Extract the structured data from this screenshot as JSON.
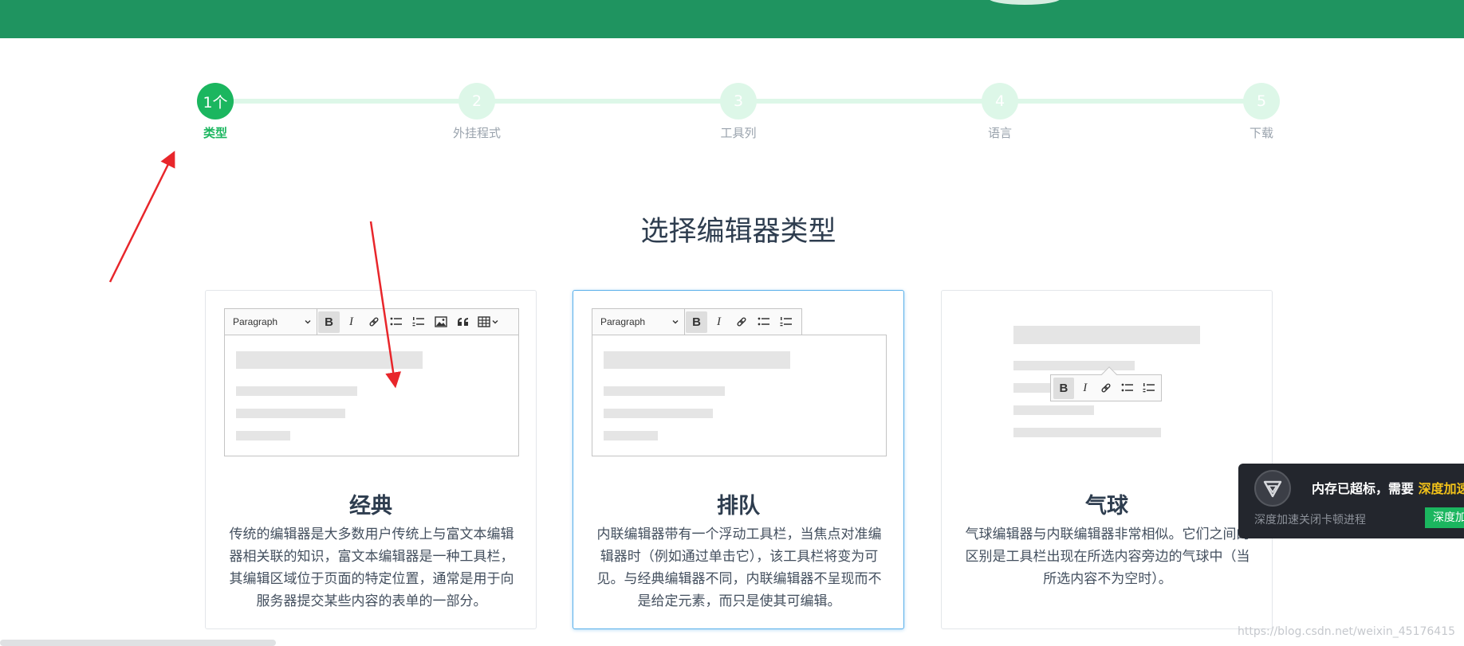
{
  "steps": [
    {
      "number": "1个",
      "label": "类型",
      "active": true
    },
    {
      "number": "2",
      "label": "外挂程式",
      "active": false
    },
    {
      "number": "3",
      "label": "工具列",
      "active": false
    },
    {
      "number": "4",
      "label": "语言",
      "active": false
    },
    {
      "number": "5",
      "label": "下载",
      "active": false
    }
  ],
  "heading": "选择编辑器类型",
  "cards": [
    {
      "title": "经典",
      "description": "传统的编辑器是大多数用户传统上与富文本编辑器相关联的知识，富文本编辑器是一种工具栏，其编辑区域位于页面的特定位置，通常是用于向服务器提交某些内容的表单的一部分。",
      "selected": false
    },
    {
      "title": "排队",
      "description": "内联编辑器带有一个浮动工具栏，当焦点对准编辑器时（例如通过单击它），该工具栏将变为可见。与经典编辑器不同，内联编辑器不呈现而不是给定元素，而只是使其可编辑。",
      "selected": true
    },
    {
      "title": "气球",
      "description": "气球编辑器与内联编辑器非常相似。它们之间的区别是工具栏出现在所选内容旁边的气球中（当所选内容不为空时）。",
      "selected": false
    }
  ],
  "toolbar": {
    "paragraph_label": "Paragraph",
    "bold": "B",
    "italic": "I"
  },
  "popup": {
    "message": "内存已超标，需要",
    "highlight": "深度加速",
    "subtext": "深度加速关闭卡顿进程",
    "button": "深度加速"
  },
  "watermark": "https://blog.csdn.net/weixin_45176415",
  "colors": {
    "banner": "#1f9460",
    "accent": "#1bb65f",
    "step_inactive": "#ddf7e8",
    "selected_border": "#5ab0ea",
    "arrow": "#e8262b",
    "popup_bg": "#23262d",
    "popup_highlight": "#f2c219"
  }
}
